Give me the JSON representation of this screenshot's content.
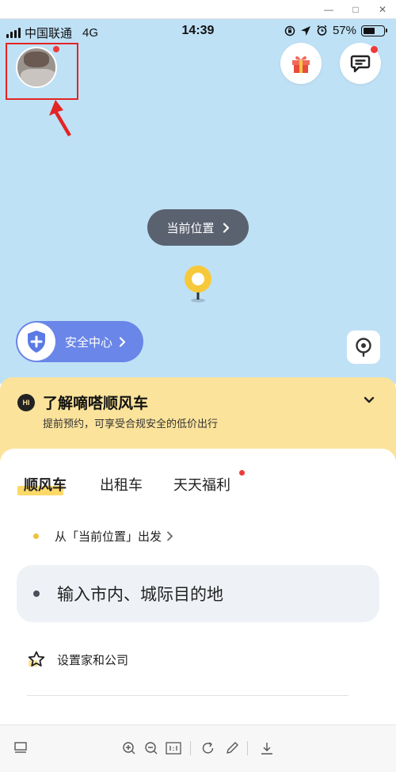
{
  "window": {
    "minimize_glyph": "—",
    "maximize_glyph": "□",
    "close_glyph": "✕"
  },
  "status_bar": {
    "carrier": "中国联通",
    "network": "4G",
    "time": "14:39",
    "battery_percent": "57%",
    "battery_level": 0.57
  },
  "map": {
    "current_location_label": "当前位置",
    "safety_center_label": "安全中心"
  },
  "banner": {
    "logo_text": "HI",
    "title": "了解嘀嗒顺风车",
    "subtitle": "提前预约，可享受合规安全的低价出行"
  },
  "tabs": [
    {
      "label": "顺风车",
      "active": true
    },
    {
      "label": "出租车",
      "active": false
    },
    {
      "label": "天天福利",
      "active": false,
      "badge": true
    }
  ],
  "trip": {
    "from_label": "从「当前位置」出发",
    "destination_placeholder": "输入市内、城际目的地",
    "home_company_label": "设置家和公司"
  },
  "colors": {
    "map_bg": "#bfe1f6",
    "banner_bg": "#fbe39b",
    "accent_yellow": "#fbd24d",
    "safety_blue": "#6a86e8",
    "badge_red": "#ee3b3b",
    "annotation_red": "#e32424"
  }
}
